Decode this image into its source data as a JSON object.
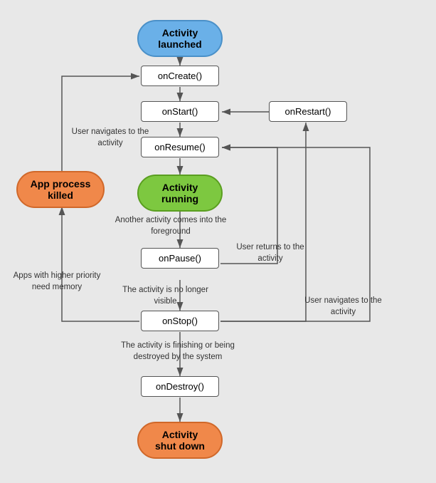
{
  "nodes": {
    "activity_launched": "Activity\nlaunched",
    "on_create": "onCreate()",
    "on_start": "onStart()",
    "on_resume": "onResume()",
    "activity_running": "Activity\nrunning",
    "on_pause": "onPause()",
    "on_stop": "onStop()",
    "on_destroy": "onDestroy()",
    "on_restart": "onRestart()",
    "activity_shutdown": "Activity\nshut down",
    "app_process_killed": "App process\nkilled"
  },
  "labels": {
    "user_navigates_to_activity_top": "User navigates\nto the activity",
    "another_activity_foreground": "Another activity comes\ninto the foreground",
    "apps_higher_priority": "Apps with higher priority\nneed memory",
    "activity_no_longer_visible": "The activity is\nno longer visible",
    "activity_finishing": "The activity is finishing or\nbeing destroyed by the system",
    "user_returns_to_activity": "User returns\nto the activity",
    "user_navigates_activity_right": "User navigates\nto the activity"
  }
}
